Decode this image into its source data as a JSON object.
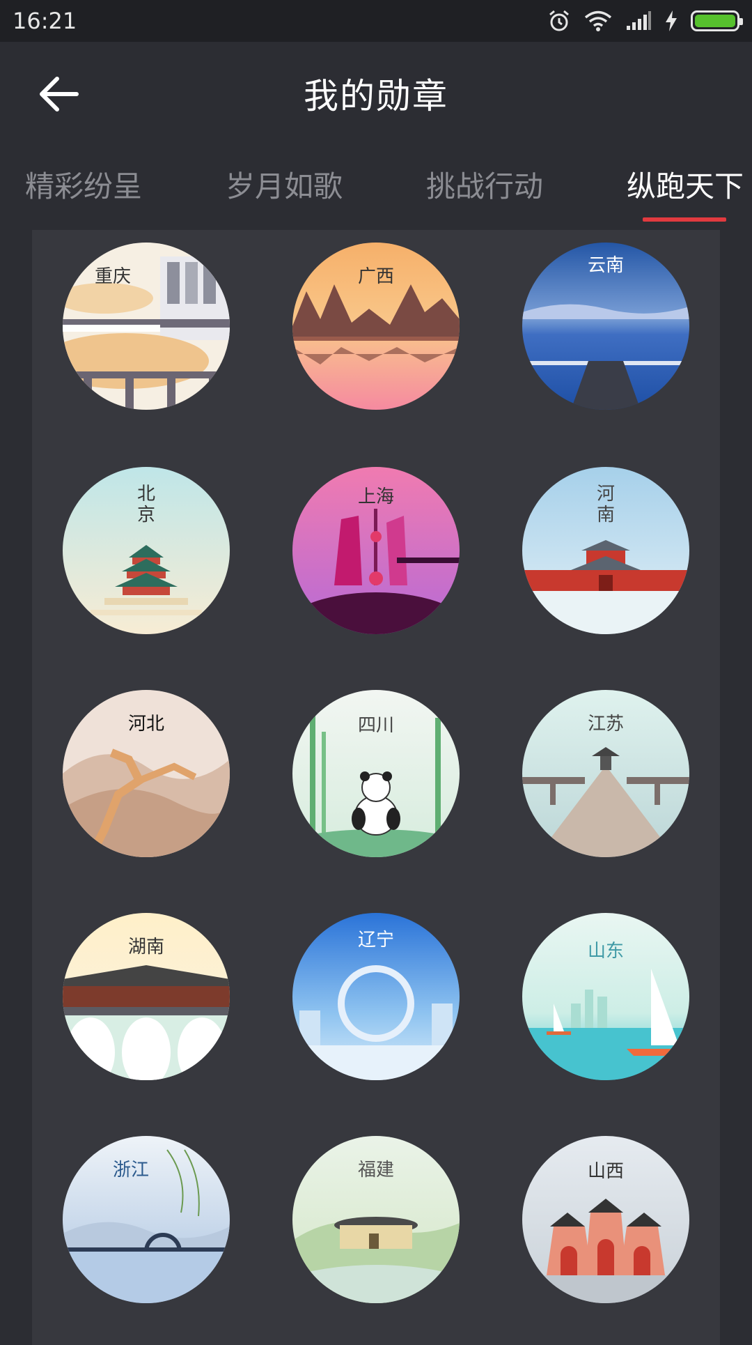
{
  "status_bar": {
    "time": "16:21",
    "icons": [
      "alarm-icon",
      "wifi-icon",
      "signal-icon",
      "charging-icon",
      "battery-icon"
    ],
    "battery_color": "#56c12d"
  },
  "header": {
    "title": "我的勋章",
    "back_icon": "arrow-left-icon"
  },
  "tabs": [
    {
      "label": "精彩纷呈",
      "active": false
    },
    {
      "label": "岁月如歌",
      "active": false
    },
    {
      "label": "挑战行动",
      "active": false
    },
    {
      "label": "纵跑天下",
      "active": true
    }
  ],
  "accent_color": "#e23a3f",
  "badges": [
    {
      "label": "重庆"
    },
    {
      "label": "广西"
    },
    {
      "label": "云南"
    },
    {
      "label": "北京"
    },
    {
      "label": "上海"
    },
    {
      "label": "河南"
    },
    {
      "label": "河北"
    },
    {
      "label": "四川"
    },
    {
      "label": "江苏"
    },
    {
      "label": "湖南"
    },
    {
      "label": "辽宁"
    },
    {
      "label": "山东"
    },
    {
      "label": "浙江"
    },
    {
      "label": "福建"
    },
    {
      "label": "山西"
    }
  ]
}
